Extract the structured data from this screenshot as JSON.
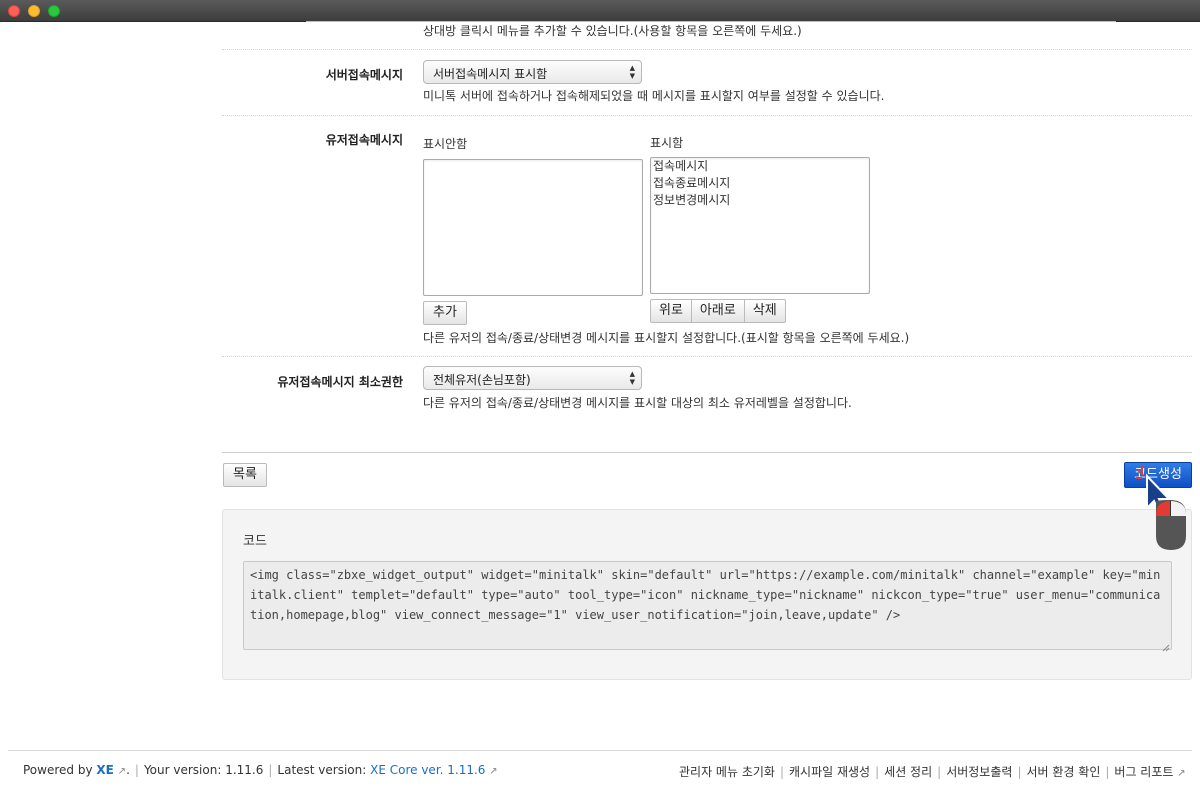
{
  "top_hint": "상대방 클릭시 메뉴를 추가할 수 있습니다.(사용할 항목을 오른쪽에 두세요.)",
  "server_msg": {
    "label": "서버접속메시지",
    "selected": "서버접속메시지 표시함",
    "hint": "미니톡 서버에 접속하거나 접속해제되었을 때 메시지를 표시할지 여부를 설정할 수 있습니다."
  },
  "user_msg": {
    "label": "유저접속메시지",
    "hidden_label": "표시안함",
    "shown_label": "표시함",
    "hidden_items": [],
    "shown_items": [
      "접속메시지",
      "접속종료메시지",
      "정보변경메시지"
    ],
    "add_button": "추가",
    "up_button": "위로",
    "down_button": "아래로",
    "delete_button": "삭제",
    "hint": "다른 유저의 접속/종료/상태변경 메시지를 표시할지 설정합니다.(표시할 항목을 오른쪽에 두세요.)"
  },
  "user_msg_perm": {
    "label": "유저접속메시지 최소권한",
    "selected": "전체유저(손님포함)",
    "hint": "다른 유저의 접속/종료/상태변경 메시지를 표시할 대상의 최소 유저레벨을 설정합니다."
  },
  "actions": {
    "list_button": "목록",
    "generate_button": "코드생성"
  },
  "code": {
    "title": "코드",
    "value": "<img class=\"zbxe_widget_output\" widget=\"minitalk\" skin=\"default\" url=\"https://example.com/minitalk\" channel=\"example\" key=\"minitalk.client\" templet=\"default\" type=\"auto\" tool_type=\"icon\" nickname_type=\"nickname\" nickcon_type=\"true\" user_menu=\"communication,homepage,blog\" view_connect_message=\"1\" view_user_notification=\"join,leave,update\" />"
  },
  "footer": {
    "powered_by": "Powered by",
    "xe": "XE",
    "dot": ".",
    "your_version_label": "Your version",
    "your_version": "1.11.6",
    "latest_version_label": "Latest version",
    "latest_version": "XE Core ver. 1.11.6",
    "links": [
      "관리자 메뉴 초기화",
      "캐시파일 재생성",
      "세션 정리",
      "서버정보출력",
      "서버 환경 확인",
      "버그 리포트"
    ]
  },
  "colors": {
    "primary": "#1554cc",
    "link": "#1a6fc4"
  },
  "icons": {
    "external": "external-link-icon",
    "cursor": "mouse-pointer-icon",
    "mouse": "mouse-click-icon"
  }
}
